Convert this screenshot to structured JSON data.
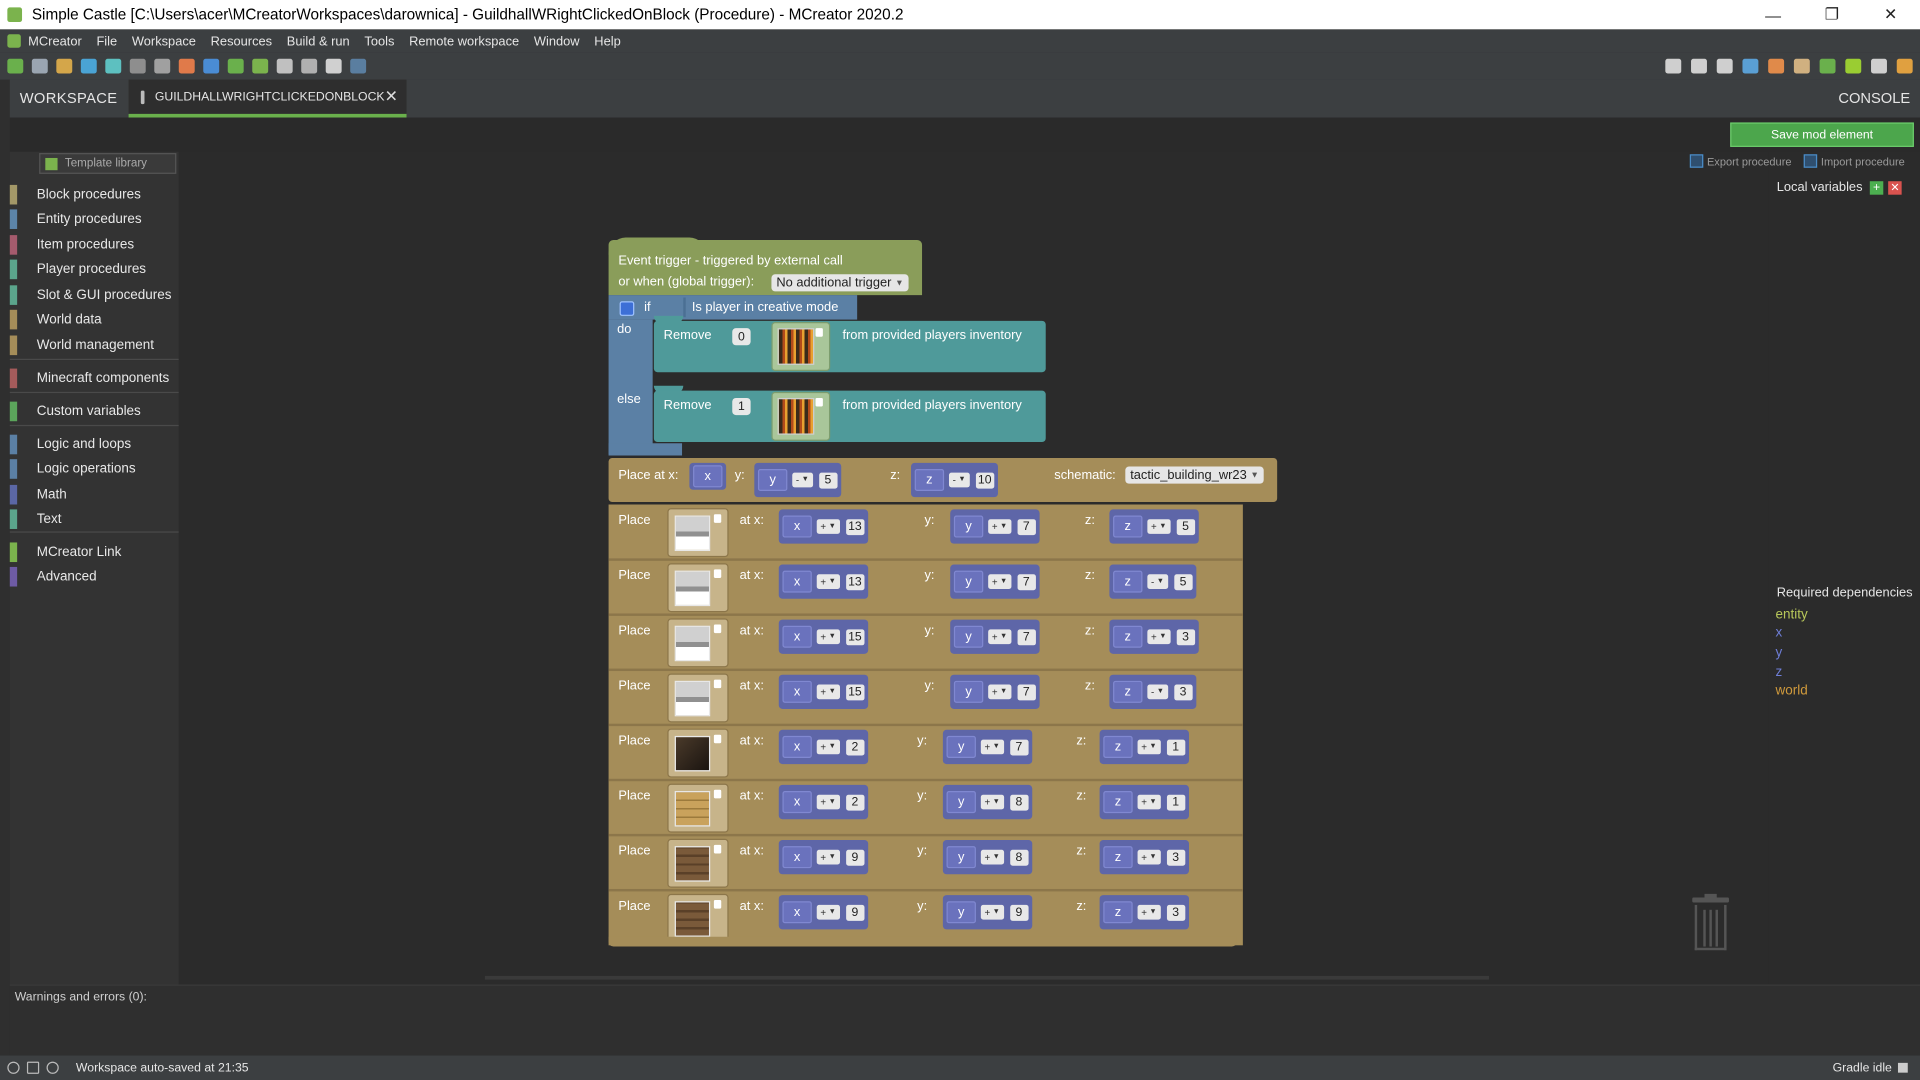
{
  "window": {
    "title": "Simple Castle [C:\\Users\\acer\\MCreatorWorkspaces\\darownica] - GuildhallWRightClickedOnBlock (Procedure) - MCreator 2020.2",
    "controls": {
      "minimize": "—",
      "maximize": "❐",
      "close": "✕"
    }
  },
  "menu": [
    "MCreator",
    "File",
    "Workspace",
    "Resources",
    "Build & run",
    "Tools",
    "Remote workspace",
    "Window",
    "Help"
  ],
  "tabs": {
    "workspace": "WORKSPACE",
    "active": "GUILDHALLWRIGHTCLICKEDONBLOCK",
    "console": "CONSOLE"
  },
  "editor": {
    "save_button": "Save mod element",
    "template_library": "Template library",
    "export_procedure": "Export procedure",
    "import_procedure": "Import procedure",
    "local_variables": "Local variables",
    "required_dependencies": "Required dependencies"
  },
  "categories": [
    {
      "label": "Block procedures",
      "color": "#a39868"
    },
    {
      "label": "Entity procedures",
      "color": "#5c84a8"
    },
    {
      "label": "Item procedures",
      "color": "#a55b6d"
    },
    {
      "label": "Player procedures",
      "color": "#5ba58c"
    },
    {
      "label": "Slot & GUI procedures",
      "color": "#5ba58c"
    },
    {
      "label": "World data",
      "color": "#a58d59"
    },
    {
      "label": "World management",
      "color": "#a58d59"
    },
    {
      "label": "Minecraft components",
      "color": "#a55b5b"
    },
    {
      "label": "Custom variables",
      "color": "#5ba55b"
    },
    {
      "label": "Logic and loops",
      "color": "#5b80a5"
    },
    {
      "label": "Logic operations",
      "color": "#5b80a5"
    },
    {
      "label": "Math",
      "color": "#5b67a5"
    },
    {
      "label": "Text",
      "color": "#5ba58c"
    },
    {
      "label": "MCreator Link",
      "color": "#7bb34d"
    },
    {
      "label": "Advanced",
      "color": "#6e5ba5"
    }
  ],
  "dependencies": [
    {
      "name": "entity",
      "color": "#b8c85a"
    },
    {
      "name": "x",
      "color": "#6f7fd8"
    },
    {
      "name": "y",
      "color": "#6f7fd8"
    },
    {
      "name": "z",
      "color": "#6f7fd8"
    },
    {
      "name": "world",
      "color": "#d09a3c"
    }
  ],
  "blocks": {
    "event_line1": "Event trigger - triggered by external call",
    "event_line2": "or when (global trigger):",
    "event_trigger_value": "No additional trigger",
    "if_label": "if",
    "do_label": "do",
    "else_label": "else",
    "condition": "Is player in creative mode",
    "remove_label": "Remove",
    "inventory_suffix": "from provided players inventory",
    "remove_do_amount": "0",
    "remove_else_amount": "1",
    "place_at_x": "Place at x:",
    "y_label": "y:",
    "z_label": "z:",
    "schematic_label": "schematic:",
    "schematic_value": "tactic_building_wr23",
    "schematic_x": "x",
    "schematic_y_var": "y",
    "schematic_y_op": "-",
    "schematic_y_val": "5",
    "schematic_z_var": "z",
    "schematic_z_op": "-",
    "schematic_z_val": "10",
    "place_label": "Place",
    "at_x_label": "at x:",
    "place_rows": [
      {
        "x_op": "+",
        "x_val": "13",
        "y_op": "+",
        "y_val": "7",
        "z_op": "+",
        "z_val": "5",
        "block": "stone-slab"
      },
      {
        "x_op": "+",
        "x_val": "13",
        "y_op": "+",
        "y_val": "7",
        "z_op": "-",
        "z_val": "5",
        "block": "stone-slab"
      },
      {
        "x_op": "+",
        "x_val": "15",
        "y_op": "+",
        "y_val": "7",
        "z_op": "+",
        "z_val": "3",
        "block": "stone-slab"
      },
      {
        "x_op": "+",
        "x_val": "15",
        "y_op": "+",
        "y_val": "7",
        "z_op": "-",
        "z_val": "3",
        "block": "stone-slab"
      },
      {
        "x_op": "+",
        "x_val": "2",
        "y_op": "+",
        "y_val": "7",
        "z_op": "+",
        "z_val": "1",
        "block": "dark-oak"
      },
      {
        "x_op": "+",
        "x_val": "2",
        "y_op": "+",
        "y_val": "8",
        "z_op": "+",
        "z_val": "1",
        "block": "oak-planks"
      },
      {
        "x_op": "+",
        "x_val": "9",
        "y_op": "+",
        "y_val": "8",
        "z_op": "+",
        "z_val": "3",
        "block": "oak-log"
      },
      {
        "x_op": "+",
        "x_val": "9",
        "y_op": "+",
        "y_val": "9",
        "z_op": "+",
        "z_val": "3",
        "block": "oak-log"
      }
    ]
  },
  "warnings": "Warnings and errors (0):",
  "status": {
    "message": "Workspace auto-saved at 21:35",
    "gradle": "Gradle idle"
  }
}
